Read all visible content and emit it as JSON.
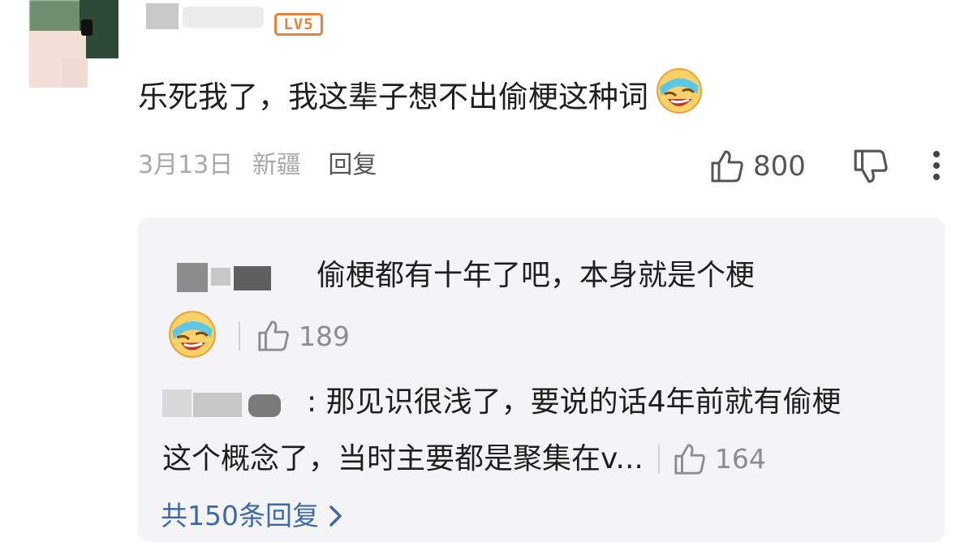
{
  "comment": {
    "level_badge": "LV5",
    "text": "乐死我了，我这辈子想不出偷梗这种词",
    "emoji_icon": "laughing-cry-emoji",
    "date": "3月13日",
    "location": "新疆",
    "reply_label": "回复",
    "like_count": "800"
  },
  "replies": [
    {
      "text": "偷梗都有十年了吧，本身就是个梗",
      "emoji_icon": "laughing-cry-emoji",
      "like_count": "189"
    },
    {
      "text_line1": ": 那见识很浅了，要说的话4年前就有偷梗",
      "text_line2": "这个概念了，当时主要都是聚集在v...",
      "like_count": "164"
    }
  ],
  "total_replies_label": "共150条回复",
  "colors": {
    "accent_link": "#3d6aa6",
    "level_badge": "#e8813a",
    "reply_bg": "#f4f4f6"
  }
}
